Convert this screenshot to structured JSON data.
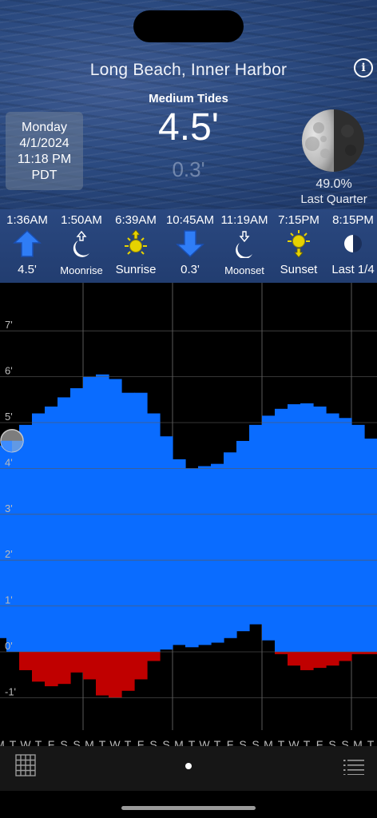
{
  "header": {
    "location": "Long Beach, Inner Harbor",
    "info_glyph": "i",
    "tide_level": "Medium Tides",
    "current_height": "4.5'",
    "next_height": "0.3'",
    "date": {
      "day": "Monday",
      "date": "4/1/2024",
      "time": "11:18 PM",
      "timezone": "PDT"
    },
    "moon": {
      "illumination": "49.0%",
      "phase": "Last Quarter",
      "icon": "moon-last-quarter-icon"
    }
  },
  "events": [
    {
      "time": "1:36AM",
      "label": "4.5'",
      "icon": "high-tide-arrow-up-icon"
    },
    {
      "time": "1:50AM",
      "label": "Moonrise",
      "icon": "moonrise-icon"
    },
    {
      "time": "6:39AM",
      "label": "Sunrise",
      "icon": "sunrise-icon"
    },
    {
      "time": "10:45AM",
      "label": "0.3'",
      "icon": "low-tide-arrow-down-icon"
    },
    {
      "time": "11:19AM",
      "label": "Moonset",
      "icon": "moonset-icon"
    },
    {
      "time": "7:15PM",
      "label": "Sunset",
      "icon": "sunset-icon"
    },
    {
      "time": "8:15PM",
      "label": "Last 1/4",
      "icon": "half-moon-icon"
    }
  ],
  "colors": {
    "high_water": "#0a6cff",
    "below_zero": "#c00000",
    "chart_background": "#000000",
    "grid": "#5a5a5a",
    "events_background": "#2a4880"
  },
  "chart_data": {
    "type": "area",
    "yunit": "ft",
    "ylim": [
      -1.6,
      8.0
    ],
    "ytick_labels": [
      "7'",
      "6'",
      "5'",
      "4'",
      "3'",
      "2'",
      "1'",
      "0'",
      "-1'"
    ],
    "yticks": [
      7,
      6,
      5,
      4,
      3,
      2,
      1,
      0,
      -1
    ],
    "x_day_labels": [
      "M",
      "T",
      "W",
      "T",
      "F",
      "S",
      "S",
      "M",
      "T",
      "W",
      "T",
      "F",
      "S",
      "S",
      "M",
      "T",
      "W",
      "T",
      "F",
      "S",
      "S",
      "M",
      "T",
      "W",
      "T",
      "F",
      "S",
      "S",
      "M",
      "T"
    ],
    "vertical_gridlines_after_day": [
      6,
      13,
      20,
      27
    ],
    "current_marker": {
      "day_index": 0,
      "value": 4.5
    },
    "series": [
      {
        "role": "daily_high",
        "values": [
          4.5,
          4.55,
          4.95,
          5.2,
          5.35,
          5.55,
          5.75,
          6.0,
          6.05,
          5.95,
          5.65,
          5.65,
          5.2,
          4.7,
          4.2,
          4.0,
          4.05,
          4.1,
          4.35,
          4.6,
          4.95,
          5.15,
          5.3,
          5.4,
          5.42,
          5.35,
          5.2,
          5.1,
          4.95,
          4.65
        ]
      },
      {
        "role": "daily_low",
        "values": [
          0.3,
          0.0,
          -0.4,
          -0.65,
          -0.75,
          -0.7,
          -0.45,
          -0.6,
          -0.95,
          -1.0,
          -0.85,
          -0.6,
          -0.2,
          0.05,
          0.15,
          0.1,
          0.15,
          0.2,
          0.3,
          0.45,
          0.6,
          0.25,
          -0.05,
          -0.3,
          -0.4,
          -0.35,
          -0.3,
          -0.2,
          -0.05,
          -0.05
        ]
      }
    ]
  },
  "toolbar": {
    "grid_icon": "grid-calendar-icon",
    "list_icon": "list-icon"
  }
}
